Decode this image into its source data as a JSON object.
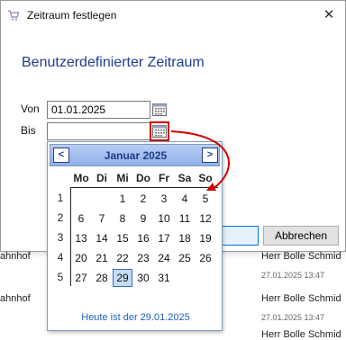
{
  "background": {
    "rows": [
      {
        "left": "ahnhof",
        "mid": "",
        "right": "Herr Bolle Schmid",
        "sub": "27.01.2025 13:47"
      },
      {
        "left": "ahnhof",
        "mid": "",
        "right": "Herr Bolle Schmid",
        "sub": "27.01.2025 13:47"
      },
      {
        "left": "",
        "mid": "",
        "right": "Herr Bolle Schmid",
        "sub": ""
      }
    ]
  },
  "dialog": {
    "title": "Zeitraum festlegen",
    "close_glyph": "✕",
    "heading": "Benutzerdefinierter Zeitraum",
    "from_label": "Von",
    "from_value": "01.01.2025",
    "to_label": "Bis",
    "to_value": "",
    "cancel_label": "Abbrechen",
    "ok_label": ""
  },
  "calendar": {
    "month_title": "Januar 2025",
    "prev_glyph": "<",
    "next_glyph": ">",
    "day_headers": [
      "Mo",
      "Di",
      "Mi",
      "Do",
      "Fr",
      "Sa",
      "So"
    ],
    "weeks": [
      "1",
      "2",
      "3",
      "4",
      "5"
    ],
    "rows": [
      [
        "",
        "",
        "1",
        "2",
        "3",
        "4",
        "5"
      ],
      [
        "6",
        "7",
        "8",
        "9",
        "10",
        "11",
        "12"
      ],
      [
        "13",
        "14",
        "15",
        "16",
        "17",
        "18",
        "19"
      ],
      [
        "20",
        "21",
        "22",
        "23",
        "24",
        "25",
        "26"
      ],
      [
        "27",
        "28",
        "29",
        "30",
        "31",
        "",
        ""
      ]
    ],
    "today": "29",
    "footer": "Heute ist der 29.01.2025"
  },
  "colors": {
    "accent": "#1f3c8c",
    "highlight": "#d00000",
    "today_bg": "#c5dcf5",
    "footer_link": "#1b5fb7"
  },
  "icons": {
    "title": "shopping-cart-icon",
    "calendar": "calendar-icon",
    "close": "close-icon"
  }
}
